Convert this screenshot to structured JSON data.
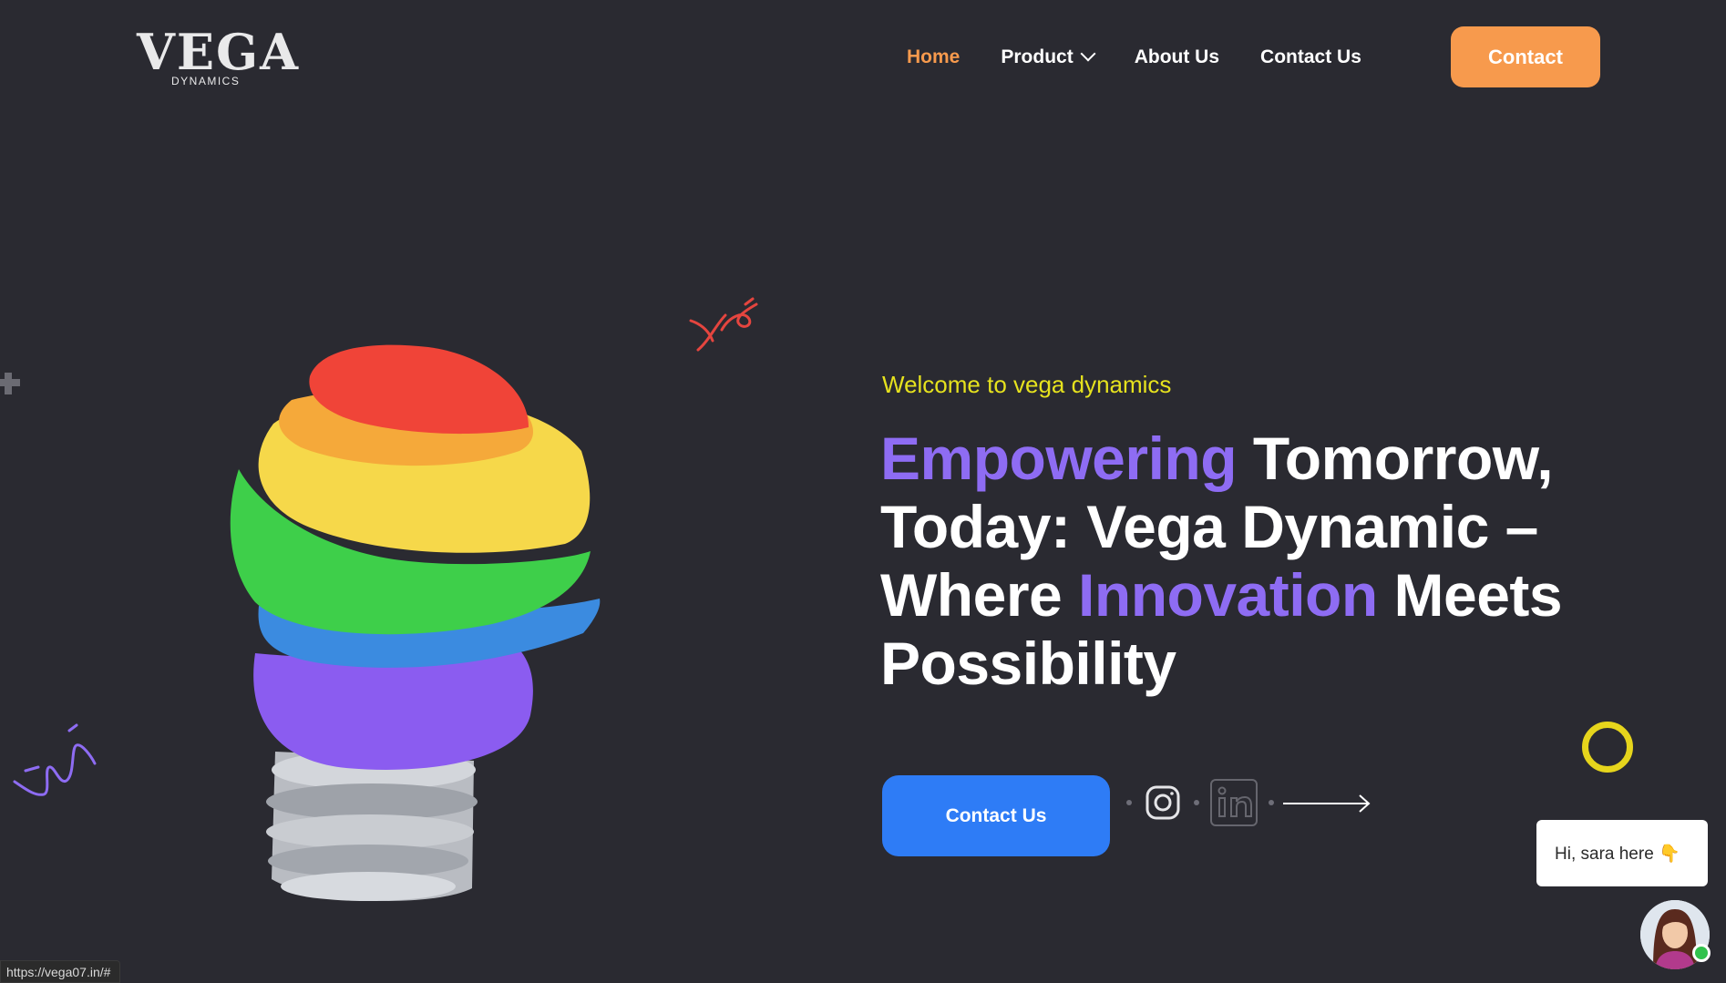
{
  "logo": {
    "word": "VEGA",
    "sub": "DYNAMICS"
  },
  "nav": {
    "items": [
      {
        "label": "Home"
      },
      {
        "label": "Product"
      },
      {
        "label": "About Us"
      },
      {
        "label": "Contact Us"
      }
    ],
    "active": "Home",
    "contact_button": "Contact"
  },
  "hero": {
    "welcome": "Welcome to vega dynamics",
    "line1_hl": "Empowering",
    "line1_rest": " Tomorrow,",
    "line2": "Today: Vega Dynamic –",
    "line3_a": "Where ",
    "line3_hl": "Innovation",
    "line3_b": " Meets",
    "line4": "Possibility",
    "cta_label": "Contact Us"
  },
  "chat": {
    "bubble_text": "Hi, sara here 👇"
  },
  "status_bar": {
    "url": "https://vega07.in/#"
  },
  "colors": {
    "background": "#2a2a31",
    "accent_orange": "#f79a4d",
    "accent_purple": "#8e6cf3",
    "accent_blue": "#2e7cf6",
    "accent_yellow": "#e6e21e"
  },
  "icons": {
    "social": [
      "instagram-icon",
      "linkedin-icon"
    ],
    "cta_arrow": "arrow-right-icon"
  }
}
